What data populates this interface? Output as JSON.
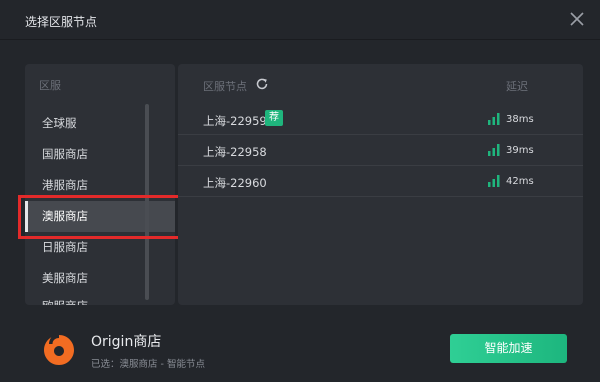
{
  "dialog": {
    "title": "选择区服节点",
    "close_icon": "close-icon"
  },
  "regions": {
    "header": "区服",
    "items": [
      {
        "label": "全球服",
        "selected": false
      },
      {
        "label": "国服商店",
        "selected": false
      },
      {
        "label": "港服商店",
        "selected": false
      },
      {
        "label": "澳服商店",
        "selected": true
      },
      {
        "label": "日服商店",
        "selected": false
      },
      {
        "label": "美服商店",
        "selected": false
      },
      {
        "label": "欧服商店",
        "selected": false
      }
    ]
  },
  "nodes": {
    "header_node": "区服节点",
    "header_latency": "延迟",
    "refresh_icon": "refresh-icon",
    "items": [
      {
        "name": "上海-22959",
        "badge": "荐",
        "latency": "38ms"
      },
      {
        "name": "上海-22958",
        "badge": "",
        "latency": "39ms"
      },
      {
        "name": "上海-22960",
        "badge": "",
        "latency": "42ms"
      }
    ]
  },
  "footer": {
    "app_name": "Origin商店",
    "selection": "已选：澳服商店 - 智能节点",
    "button_label": "智能加速",
    "logo_icon": "origin-logo-icon"
  },
  "colors": {
    "accent_green": "#1fb57d",
    "highlight_red": "#e32a2a",
    "logo_orange": "#f26c22"
  }
}
